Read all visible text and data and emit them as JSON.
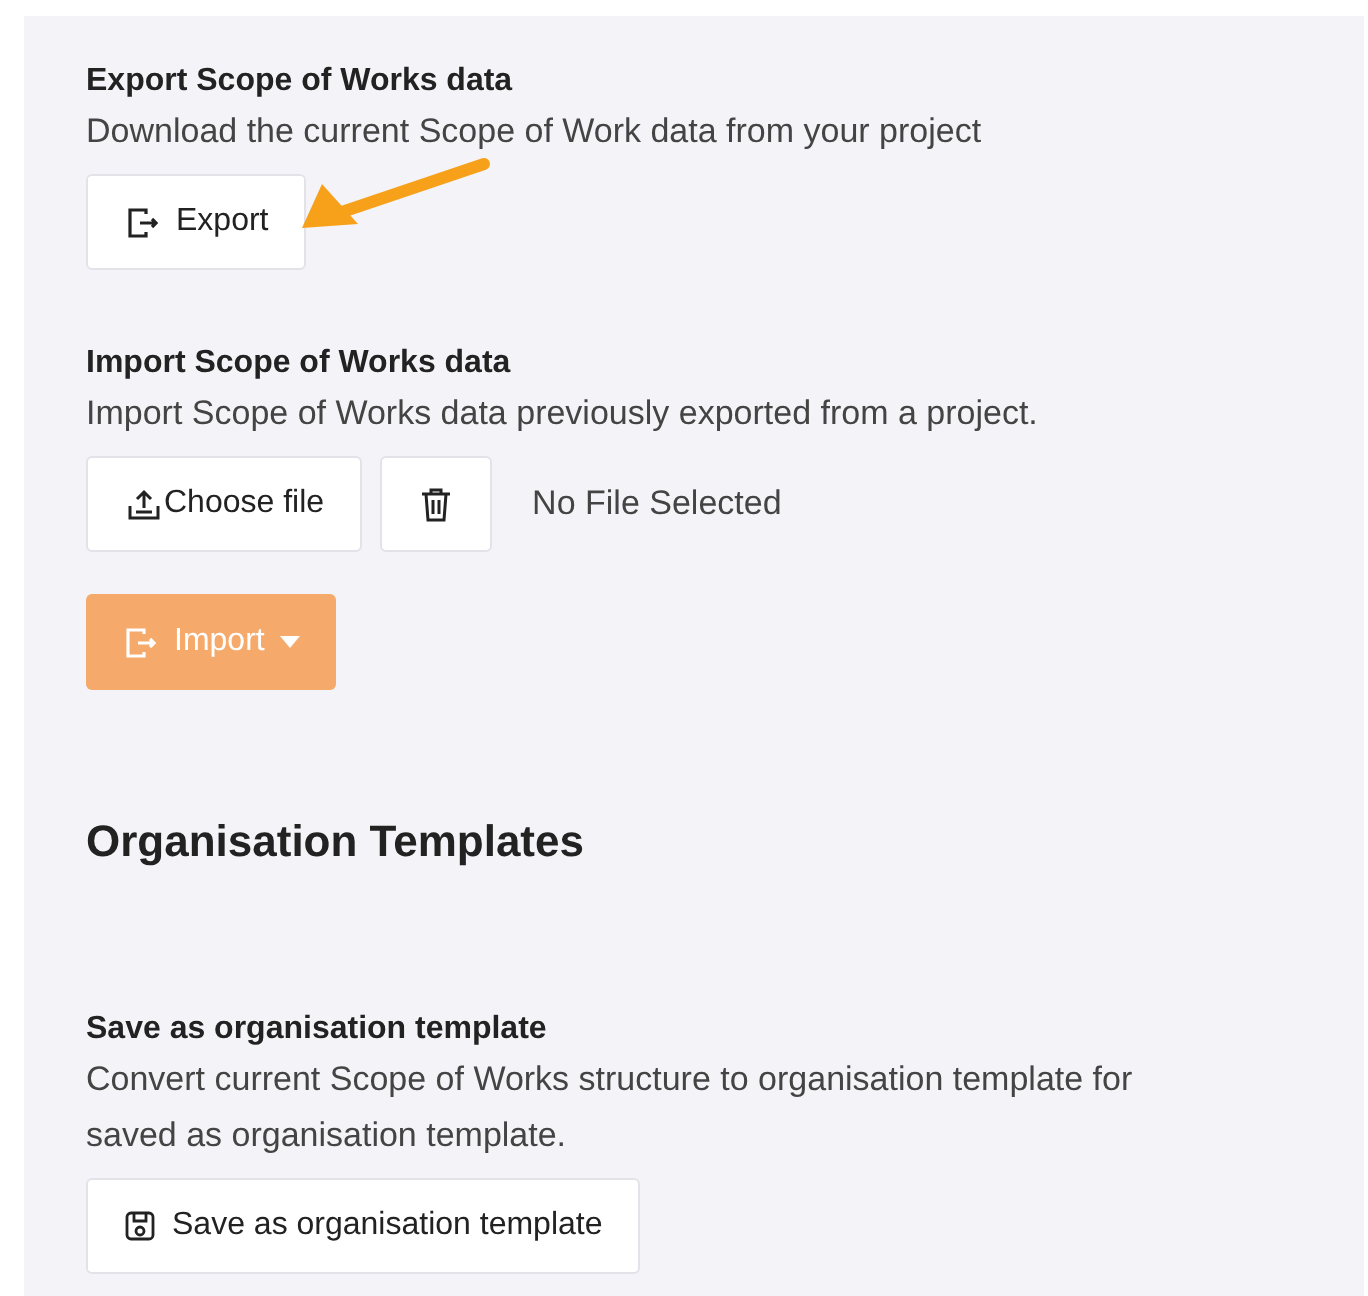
{
  "export_section": {
    "title": "Export Scope of Works data",
    "description": "Download the current Scope of Work data from your project",
    "button": "Export"
  },
  "import_section": {
    "title": "Import Scope of Works data",
    "description": "Import Scope of Works data previously exported from a project.",
    "choose_button": "Choose file",
    "file_status": "No File Selected",
    "import_button": {
      "label": "Import",
      "disabled": true
    }
  },
  "templates_heading": "Organisation Templates",
  "template_section": {
    "title": "Save as organisation template",
    "description_lines": [
      "Convert current Scope of Works structure to organisation template for",
      "saved as organisation template."
    ],
    "button": "Save as organisation template"
  },
  "annotation": {
    "kind": "arrow"
  }
}
